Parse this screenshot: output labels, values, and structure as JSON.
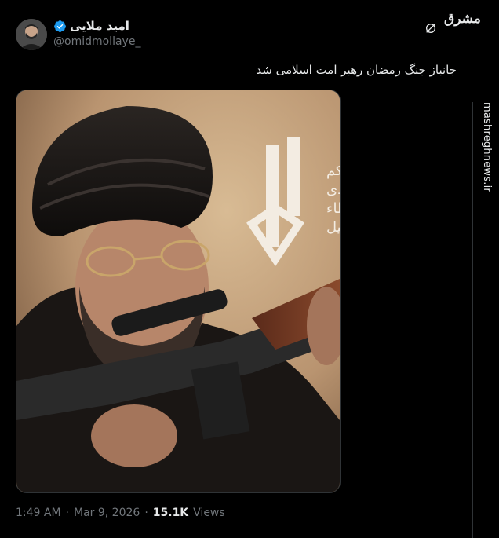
{
  "author": {
    "display_name": "امید ملایی",
    "handle": "@omidmollaye_",
    "verified": true
  },
  "tweet": {
    "text": "جانباز جنگ رمضان رهبر امت اسلامی شد"
  },
  "media": {
    "poster_calligraphy_lines": [
      "اعطیکم",
      "بیدی",
      "اعطاء",
      "الذلیل"
    ]
  },
  "meta": {
    "time": "1:49 AM",
    "separator": "·",
    "date": "Mar 9, 2026",
    "views_count": "15.1K",
    "views_label": "Views"
  },
  "watermark": {
    "logo": "مشرق",
    "url": "mashreghnews.ir"
  },
  "colors": {
    "background": "#000000",
    "verified_blue": "#1d9bf0",
    "muted_text": "#71767b",
    "primary_text": "#e7e9ea"
  }
}
